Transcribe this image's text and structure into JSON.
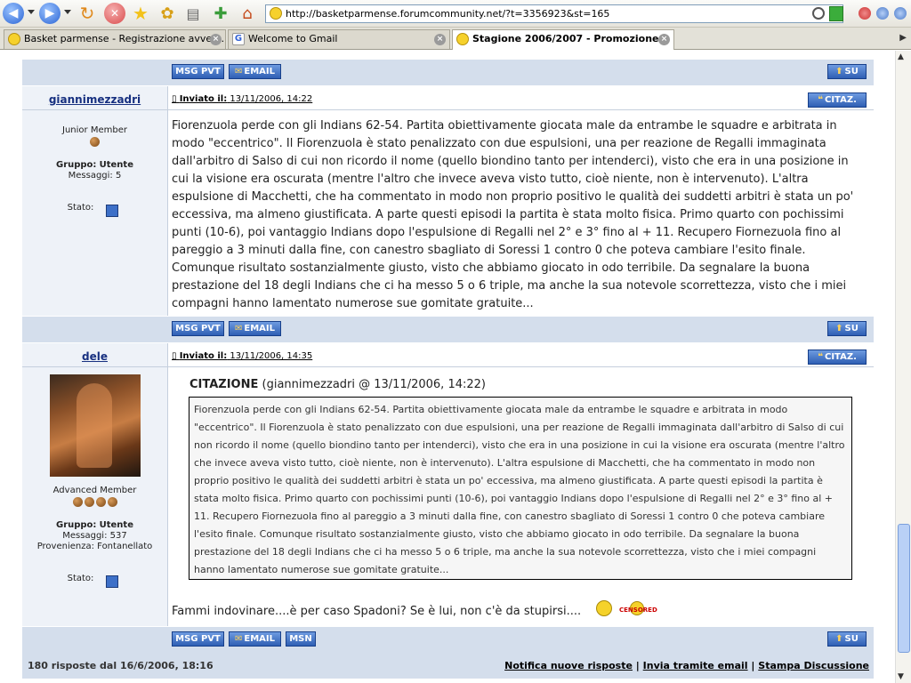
{
  "browser": {
    "url": "http://basketparmense.forumcommunity.net/?t=3356923&st=165",
    "tabs": [
      {
        "label": "Basket parmense - Registrazione avven..."
      },
      {
        "label": "Welcome to Gmail"
      },
      {
        "label": "Stagione 2006/2007 - Promozione"
      }
    ]
  },
  "labels": {
    "msg_pvt": "MSG PVT",
    "email": "EMAIL",
    "msn": "MSN",
    "su": "SU",
    "citaz": "CITAZ.",
    "inviato_il": "Inviato il:",
    "gruppo": "Gruppo:",
    "messaggi": "Messaggi:",
    "provenienza": "Provenienza:",
    "stato": "Stato:",
    "citazione": "CITAZIONE"
  },
  "posts": [
    {
      "author": "giannimezzadri",
      "rank": "Junior Member",
      "rank_pips": 1,
      "group": "Utente",
      "messages": "5",
      "date": "13/11/2006, 14:22",
      "body": "Fiorenzuola perde con gli Indians 62-54. Partita obiettivamente giocata male da entrambe le squadre e arbitrata in modo \"eccentrico\". Il Fiorenzuola è stato penalizzato con due espulsioni, una per reazione de Regalli immaginata dall'arbitro di Salso di cui non ricordo il nome (quello biondino tanto per intenderci), visto che era in una posizione in cui la visione era oscurata (mentre l'altro che invece aveva visto tutto, cioè niente, non è intervenuto). L'altra espulsione di Macchetti, che ha commentato in modo non proprio positivo le qualità dei suddetti arbitri è stata un po' eccessiva, ma almeno giustificata. A parte questi episodi la partita è stata molto fisica. Primo quarto con pochissimi punti (10-6), poi vantaggio Indians dopo l'espulsione di Regalli nel 2° e 3° fino al + 11. Recupero Fiornezuola fino al pareggio a 3 minuti dalla fine, con canestro sbagliato di Soressi 1 contro 0 che poteva cambiare l'esito finale. Comunque risultato sostanzialmente giusto, visto che abbiamo giocato in odo terribile. Da segnalare la buona prestazione del 18 degli Indians che ci ha messo 5 o 6 triple, ma anche la sua notevole scorrettezza, visto che i miei compagni hanno lamentato numerose sue gomitate gratuite..."
    },
    {
      "author": "dele",
      "rank": "Advanced Member",
      "rank_pips": 4,
      "group": "Utente",
      "messages": "537",
      "provenienza": "Fontanellato",
      "date": "13/11/2006, 14:35",
      "quote_source": "(giannimezzadri @ 13/11/2006, 14:22)",
      "quote_body": "Fiorenzuola perde con gli Indians 62-54. Partita obiettivamente giocata male da entrambe le squadre e arbitrata in modo \"eccentrico\". Il Fiorenzuola è stato penalizzato con due espulsioni, una per reazione de Regalli immaginata dall'arbitro di Salso di cui non ricordo il nome (quello biondino tanto per intenderci), visto che era in una posizione in cui la visione era oscurata (mentre l'altro che invece aveva visto tutto, cioè niente, non è intervenuto). L'altra espulsione di Macchetti, che ha commentato in modo non proprio positivo le qualità dei suddetti arbitri è stata un po' eccessiva, ma almeno giustificata. A parte questi episodi la partita è stata molto fisica. Primo quarto con pochissimi punti (10-6), poi vantaggio Indians dopo l'espulsione di Regalli nel 2° e 3° fino al + 11. Recupero Fiornezuola fino al pareggio a 3 minuti dalla fine, con canestro sbagliato di Soressi 1 contro 0 che poteva cambiare l'esito finale. Comunque risultato sostanzialmente giusto, visto che abbiamo giocato in odo terribile. Da segnalare la buona prestazione del 18 degli Indians che ci ha messo 5 o 6 triple, ma anche la sua notevole scorrettezza, visto che i miei compagni hanno lamentato numerose sue gomitate gratuite...",
      "body": "Fammi indovinare....è per caso Spadoni? Se è lui, non c'è da stupirsi....",
      "censored": "CENSORED"
    }
  ],
  "footer": {
    "replies": "180 risposte dal 16/6/2006, 18:16",
    "link_notify": "Notifica nuove risposte",
    "link_email": "Invia tramite email",
    "link_print": "Stampa Discussione",
    "sep": "|"
  }
}
